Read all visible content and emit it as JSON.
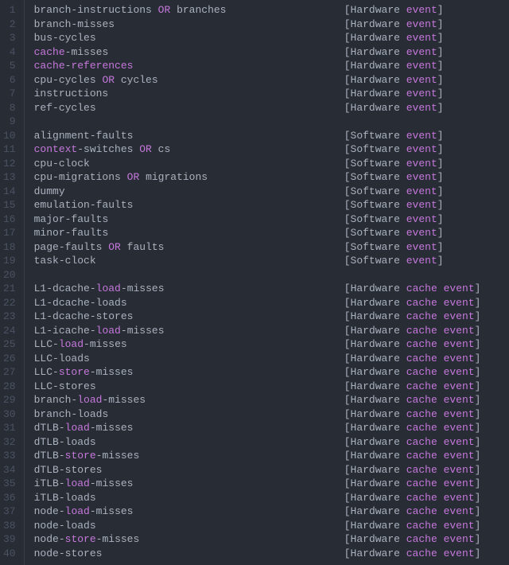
{
  "colors": {
    "bg": "#282c34",
    "fg": "#abb2bf",
    "gutter": "#4b5263",
    "keyword": "#c678dd",
    "ident": "#c678dd"
  },
  "event_column": 50,
  "lines": [
    {
      "num": 1,
      "tokens": [
        [
          "plain",
          "branch"
        ],
        [
          "punct",
          "-"
        ],
        [
          "plain",
          "instructions "
        ],
        [
          "keyword",
          "OR"
        ],
        [
          "plain",
          " branches"
        ]
      ],
      "event": [
        "[",
        "Hardware ",
        "event",
        "]"
      ]
    },
    {
      "num": 2,
      "tokens": [
        [
          "plain",
          "branch"
        ],
        [
          "punct",
          "-"
        ],
        [
          "plain",
          "misses"
        ]
      ],
      "event": [
        "[",
        "Hardware ",
        "event",
        "]"
      ]
    },
    {
      "num": 3,
      "tokens": [
        [
          "plain",
          "bus"
        ],
        [
          "punct",
          "-"
        ],
        [
          "plain",
          "cycles"
        ]
      ],
      "event": [
        "[",
        "Hardware ",
        "event",
        "]"
      ]
    },
    {
      "num": 4,
      "tokens": [
        [
          "ident",
          "cache"
        ],
        [
          "punct",
          "-"
        ],
        [
          "plain",
          "misses"
        ]
      ],
      "event": [
        "[",
        "Hardware ",
        "event",
        "]"
      ]
    },
    {
      "num": 5,
      "tokens": [
        [
          "ident",
          "cache"
        ],
        [
          "punct",
          "-"
        ],
        [
          "ident",
          "references"
        ]
      ],
      "event": [
        "[",
        "Hardware ",
        "event",
        "]"
      ]
    },
    {
      "num": 6,
      "tokens": [
        [
          "plain",
          "cpu"
        ],
        [
          "punct",
          "-"
        ],
        [
          "plain",
          "cycles "
        ],
        [
          "keyword",
          "OR"
        ],
        [
          "plain",
          " cycles"
        ]
      ],
      "event": [
        "[",
        "Hardware ",
        "event",
        "]"
      ]
    },
    {
      "num": 7,
      "tokens": [
        [
          "plain",
          "instructions"
        ]
      ],
      "event": [
        "[",
        "Hardware ",
        "event",
        "]"
      ]
    },
    {
      "num": 8,
      "tokens": [
        [
          "plain",
          "ref"
        ],
        [
          "punct",
          "-"
        ],
        [
          "plain",
          "cycles"
        ]
      ],
      "event": [
        "[",
        "Hardware ",
        "event",
        "]"
      ]
    },
    {
      "num": 9,
      "tokens": [],
      "event": null
    },
    {
      "num": 10,
      "tokens": [
        [
          "plain",
          "alignment"
        ],
        [
          "punct",
          "-"
        ],
        [
          "plain",
          "faults"
        ]
      ],
      "event": [
        "[",
        "Software ",
        "event",
        "]"
      ]
    },
    {
      "num": 11,
      "tokens": [
        [
          "ident",
          "context"
        ],
        [
          "punct",
          "-"
        ],
        [
          "plain",
          "switches "
        ],
        [
          "keyword",
          "OR"
        ],
        [
          "plain",
          " cs"
        ]
      ],
      "event": [
        "[",
        "Software ",
        "event",
        "]"
      ]
    },
    {
      "num": 12,
      "tokens": [
        [
          "plain",
          "cpu"
        ],
        [
          "punct",
          "-"
        ],
        [
          "plain",
          "clock"
        ]
      ],
      "event": [
        "[",
        "Software ",
        "event",
        "]"
      ]
    },
    {
      "num": 13,
      "tokens": [
        [
          "plain",
          "cpu"
        ],
        [
          "punct",
          "-"
        ],
        [
          "plain",
          "migrations "
        ],
        [
          "keyword",
          "OR"
        ],
        [
          "plain",
          " migrations"
        ]
      ],
      "event": [
        "[",
        "Software ",
        "event",
        "]"
      ]
    },
    {
      "num": 14,
      "tokens": [
        [
          "plain",
          "dummy"
        ]
      ],
      "event": [
        "[",
        "Software ",
        "event",
        "]"
      ]
    },
    {
      "num": 15,
      "tokens": [
        [
          "plain",
          "emulation"
        ],
        [
          "punct",
          "-"
        ],
        [
          "plain",
          "faults"
        ]
      ],
      "event": [
        "[",
        "Software ",
        "event",
        "]"
      ]
    },
    {
      "num": 16,
      "tokens": [
        [
          "plain",
          "major"
        ],
        [
          "punct",
          "-"
        ],
        [
          "plain",
          "faults"
        ]
      ],
      "event": [
        "[",
        "Software ",
        "event",
        "]"
      ]
    },
    {
      "num": 17,
      "tokens": [
        [
          "plain",
          "minor"
        ],
        [
          "punct",
          "-"
        ],
        [
          "plain",
          "faults"
        ]
      ],
      "event": [
        "[",
        "Software ",
        "event",
        "]"
      ]
    },
    {
      "num": 18,
      "tokens": [
        [
          "plain",
          "page"
        ],
        [
          "punct",
          "-"
        ],
        [
          "plain",
          "faults "
        ],
        [
          "keyword",
          "OR"
        ],
        [
          "plain",
          " faults"
        ]
      ],
      "event": [
        "[",
        "Software ",
        "event",
        "]"
      ]
    },
    {
      "num": 19,
      "tokens": [
        [
          "plain",
          "task"
        ],
        [
          "punct",
          "-"
        ],
        [
          "plain",
          "clock"
        ]
      ],
      "event": [
        "[",
        "Software ",
        "event",
        "]"
      ]
    },
    {
      "num": 20,
      "tokens": [],
      "event": null
    },
    {
      "num": 21,
      "tokens": [
        [
          "plain",
          "L1"
        ],
        [
          "punct",
          "-"
        ],
        [
          "plain",
          "dcache"
        ],
        [
          "punct",
          "-"
        ],
        [
          "ident",
          "load"
        ],
        [
          "punct",
          "-"
        ],
        [
          "plain",
          "misses"
        ]
      ],
      "event": [
        "[",
        "Hardware ",
        "cache",
        " ",
        "event",
        "]"
      ]
    },
    {
      "num": 22,
      "tokens": [
        [
          "plain",
          "L1"
        ],
        [
          "punct",
          "-"
        ],
        [
          "plain",
          "dcache"
        ],
        [
          "punct",
          "-"
        ],
        [
          "plain",
          "loads"
        ]
      ],
      "event": [
        "[",
        "Hardware ",
        "cache",
        " ",
        "event",
        "]"
      ]
    },
    {
      "num": 23,
      "tokens": [
        [
          "plain",
          "L1"
        ],
        [
          "punct",
          "-"
        ],
        [
          "plain",
          "dcache"
        ],
        [
          "punct",
          "-"
        ],
        [
          "plain",
          "stores"
        ]
      ],
      "event": [
        "[",
        "Hardware ",
        "cache",
        " ",
        "event",
        "]"
      ]
    },
    {
      "num": 24,
      "tokens": [
        [
          "plain",
          "L1"
        ],
        [
          "punct",
          "-"
        ],
        [
          "plain",
          "icache"
        ],
        [
          "punct",
          "-"
        ],
        [
          "ident",
          "load"
        ],
        [
          "punct",
          "-"
        ],
        [
          "plain",
          "misses"
        ]
      ],
      "event": [
        "[",
        "Hardware ",
        "cache",
        " ",
        "event",
        "]"
      ]
    },
    {
      "num": 25,
      "tokens": [
        [
          "plain",
          "LLC"
        ],
        [
          "punct",
          "-"
        ],
        [
          "ident",
          "load"
        ],
        [
          "punct",
          "-"
        ],
        [
          "plain",
          "misses"
        ]
      ],
      "event": [
        "[",
        "Hardware ",
        "cache",
        " ",
        "event",
        "]"
      ]
    },
    {
      "num": 26,
      "tokens": [
        [
          "plain",
          "LLC"
        ],
        [
          "punct",
          "-"
        ],
        [
          "plain",
          "loads"
        ]
      ],
      "event": [
        "[",
        "Hardware ",
        "cache",
        " ",
        "event",
        "]"
      ]
    },
    {
      "num": 27,
      "tokens": [
        [
          "plain",
          "LLC"
        ],
        [
          "punct",
          "-"
        ],
        [
          "ident",
          "store"
        ],
        [
          "punct",
          "-"
        ],
        [
          "plain",
          "misses"
        ]
      ],
      "event": [
        "[",
        "Hardware ",
        "cache",
        " ",
        "event",
        "]"
      ]
    },
    {
      "num": 28,
      "tokens": [
        [
          "plain",
          "LLC"
        ],
        [
          "punct",
          "-"
        ],
        [
          "plain",
          "stores"
        ]
      ],
      "event": [
        "[",
        "Hardware ",
        "cache",
        " ",
        "event",
        "]"
      ]
    },
    {
      "num": 29,
      "tokens": [
        [
          "plain",
          "branch"
        ],
        [
          "punct",
          "-"
        ],
        [
          "ident",
          "load"
        ],
        [
          "punct",
          "-"
        ],
        [
          "plain",
          "misses"
        ]
      ],
      "event": [
        "[",
        "Hardware ",
        "cache",
        " ",
        "event",
        "]"
      ]
    },
    {
      "num": 30,
      "tokens": [
        [
          "plain",
          "branch"
        ],
        [
          "punct",
          "-"
        ],
        [
          "plain",
          "loads"
        ]
      ],
      "event": [
        "[",
        "Hardware ",
        "cache",
        " ",
        "event",
        "]"
      ]
    },
    {
      "num": 31,
      "tokens": [
        [
          "plain",
          "dTLB"
        ],
        [
          "punct",
          "-"
        ],
        [
          "ident",
          "load"
        ],
        [
          "punct",
          "-"
        ],
        [
          "plain",
          "misses"
        ]
      ],
      "event": [
        "[",
        "Hardware ",
        "cache",
        " ",
        "event",
        "]"
      ]
    },
    {
      "num": 32,
      "tokens": [
        [
          "plain",
          "dTLB"
        ],
        [
          "punct",
          "-"
        ],
        [
          "plain",
          "loads"
        ]
      ],
      "event": [
        "[",
        "Hardware ",
        "cache",
        " ",
        "event",
        "]"
      ]
    },
    {
      "num": 33,
      "tokens": [
        [
          "plain",
          "dTLB"
        ],
        [
          "punct",
          "-"
        ],
        [
          "ident",
          "store"
        ],
        [
          "punct",
          "-"
        ],
        [
          "plain",
          "misses"
        ]
      ],
      "event": [
        "[",
        "Hardware ",
        "cache",
        " ",
        "event",
        "]"
      ]
    },
    {
      "num": 34,
      "tokens": [
        [
          "plain",
          "dTLB"
        ],
        [
          "punct",
          "-"
        ],
        [
          "plain",
          "stores"
        ]
      ],
      "event": [
        "[",
        "Hardware ",
        "cache",
        " ",
        "event",
        "]"
      ]
    },
    {
      "num": 35,
      "tokens": [
        [
          "plain",
          "iTLB"
        ],
        [
          "punct",
          "-"
        ],
        [
          "ident",
          "load"
        ],
        [
          "punct",
          "-"
        ],
        [
          "plain",
          "misses"
        ]
      ],
      "event": [
        "[",
        "Hardware ",
        "cache",
        " ",
        "event",
        "]"
      ]
    },
    {
      "num": 36,
      "tokens": [
        [
          "plain",
          "iTLB"
        ],
        [
          "punct",
          "-"
        ],
        [
          "plain",
          "loads"
        ]
      ],
      "event": [
        "[",
        "Hardware ",
        "cache",
        " ",
        "event",
        "]"
      ]
    },
    {
      "num": 37,
      "tokens": [
        [
          "plain",
          "node"
        ],
        [
          "punct",
          "-"
        ],
        [
          "ident",
          "load"
        ],
        [
          "punct",
          "-"
        ],
        [
          "plain",
          "misses"
        ]
      ],
      "event": [
        "[",
        "Hardware ",
        "cache",
        " ",
        "event",
        "]"
      ]
    },
    {
      "num": 38,
      "tokens": [
        [
          "plain",
          "node"
        ],
        [
          "punct",
          "-"
        ],
        [
          "plain",
          "loads"
        ]
      ],
      "event": [
        "[",
        "Hardware ",
        "cache",
        " ",
        "event",
        "]"
      ]
    },
    {
      "num": 39,
      "tokens": [
        [
          "plain",
          "node"
        ],
        [
          "punct",
          "-"
        ],
        [
          "ident",
          "store"
        ],
        [
          "punct",
          "-"
        ],
        [
          "plain",
          "misses"
        ]
      ],
      "event": [
        "[",
        "Hardware ",
        "cache",
        " ",
        "event",
        "]"
      ]
    },
    {
      "num": 40,
      "tokens": [
        [
          "plain",
          "node"
        ],
        [
          "punct",
          "-"
        ],
        [
          "plain",
          "stores"
        ]
      ],
      "event": [
        "[",
        "Hardware ",
        "cache",
        " ",
        "event",
        "]"
      ]
    }
  ]
}
